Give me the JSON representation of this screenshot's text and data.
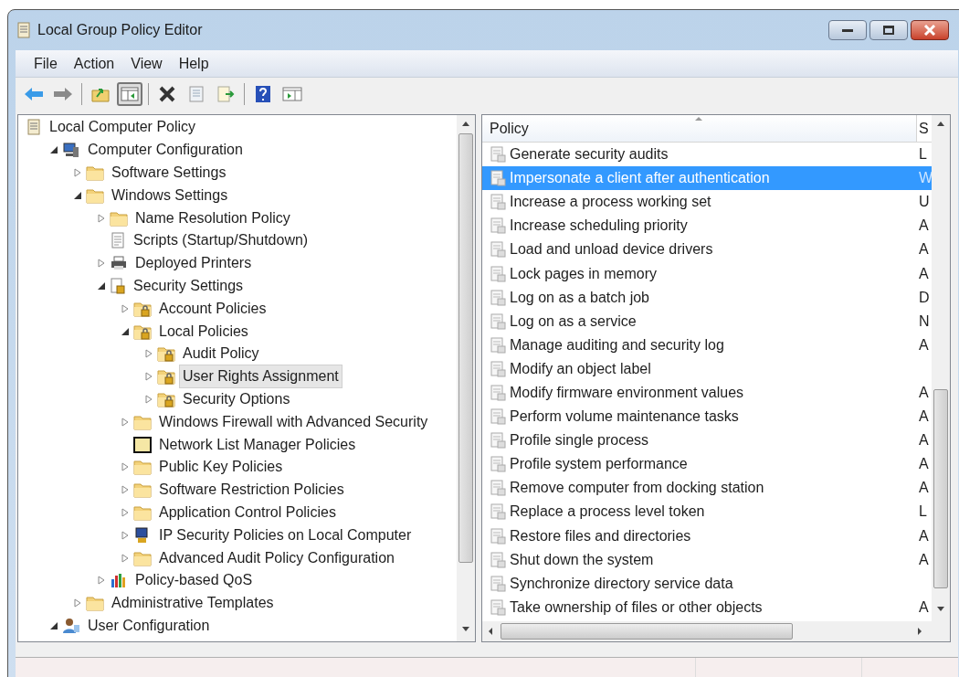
{
  "window": {
    "title": "Local Group Policy Editor"
  },
  "menu": [
    "File",
    "Action",
    "View",
    "Help"
  ],
  "toolbar": [
    {
      "kind": "back",
      "pressed": false
    },
    {
      "kind": "forward",
      "pressed": false
    },
    {
      "kind": "sep"
    },
    {
      "kind": "up",
      "pressed": false
    },
    {
      "kind": "tree",
      "pressed": true
    },
    {
      "kind": "sep"
    },
    {
      "kind": "delete",
      "pressed": false
    },
    {
      "kind": "properties",
      "pressed": false
    },
    {
      "kind": "export",
      "pressed": false
    },
    {
      "kind": "sep"
    },
    {
      "kind": "help",
      "pressed": false
    },
    {
      "kind": "pane",
      "pressed": false
    }
  ],
  "tree": [
    {
      "label": "Local Computer Policy",
      "kind": "policy",
      "selected": false,
      "children": [
        {
          "label": "Computer Configuration",
          "kind": "computer",
          "expanded": true,
          "selected": false,
          "children": [
            {
              "label": "Software Settings",
              "kind": "folder",
              "expanded": false,
              "selected": false
            },
            {
              "label": "Windows Settings",
              "kind": "folder",
              "expanded": true,
              "selected": false,
              "children": [
                {
                  "label": "Name Resolution Policy",
                  "kind": "folder",
                  "expanded": false,
                  "selected": false
                },
                {
                  "label": "Scripts (Startup/Shutdown)",
                  "kind": "script",
                  "selected": false
                },
                {
                  "label": "Deployed Printers",
                  "kind": "printer",
                  "expanded": false,
                  "selected": false
                },
                {
                  "label": "Security Settings",
                  "kind": "security",
                  "expanded": true,
                  "selected": false,
                  "children": [
                    {
                      "label": "Account Policies",
                      "kind": "locked",
                      "expanded": false,
                      "selected": false
                    },
                    {
                      "label": "Local Policies",
                      "kind": "locked",
                      "expanded": true,
                      "selected": false,
                      "children": [
                        {
                          "label": "Audit Policy",
                          "kind": "locked",
                          "expanded": false,
                          "selected": false
                        },
                        {
                          "label": "User Rights Assignment",
                          "kind": "locked",
                          "expanded": false,
                          "selected": true
                        },
                        {
                          "label": "Security Options",
                          "kind": "locked",
                          "expanded": false,
                          "selected": false
                        }
                      ]
                    },
                    {
                      "label": "Windows Firewall with Advanced Security",
                      "kind": "folder",
                      "expanded": false,
                      "selected": false
                    },
                    {
                      "label": "Network List Manager Policies",
                      "kind": "network",
                      "selected": false
                    },
                    {
                      "label": "Public Key Policies",
                      "kind": "folder",
                      "expanded": false,
                      "selected": false
                    },
                    {
                      "label": "Software Restriction Policies",
                      "kind": "folder",
                      "expanded": false,
                      "selected": false
                    },
                    {
                      "label": "Application Control Policies",
                      "kind": "folder",
                      "expanded": false,
                      "selected": false
                    },
                    {
                      "label": "IP Security Policies on Local Computer",
                      "kind": "ip",
                      "expanded": false,
                      "selected": false
                    },
                    {
                      "label": "Advanced Audit Policy Configuration",
                      "kind": "folder",
                      "expanded": false,
                      "selected": false
                    }
                  ]
                },
                {
                  "label": "Policy-based QoS",
                  "kind": "qos",
                  "expanded": false,
                  "selected": false
                }
              ]
            },
            {
              "label": "Administrative Templates",
              "kind": "folder",
              "expanded": false,
              "selected": false
            }
          ]
        },
        {
          "label": "User Configuration",
          "kind": "user",
          "expanded": true,
          "selected": false
        }
      ]
    }
  ],
  "table": {
    "columns": [
      "Policy",
      "S"
    ],
    "rows": [
      {
        "policy": "Generate security audits",
        "column_2": "L",
        "selected": false
      },
      {
        "policy": "Impersonate a client after authentication",
        "column_2": "W",
        "selected": true
      },
      {
        "policy": "Increase a process working set",
        "column_2": "U",
        "selected": false
      },
      {
        "policy": "Increase scheduling priority",
        "column_2": "A",
        "selected": false
      },
      {
        "policy": "Load and unload device drivers",
        "column_2": "A",
        "selected": false
      },
      {
        "policy": "Lock pages in memory",
        "column_2": "A",
        "selected": false
      },
      {
        "policy": "Log on as a batch job",
        "column_2": "D",
        "selected": false
      },
      {
        "policy": "Log on as a service",
        "column_2": "N",
        "selected": false
      },
      {
        "policy": "Manage auditing and security log",
        "column_2": "A",
        "selected": false
      },
      {
        "policy": "Modify an object label",
        "selected": false
      },
      {
        "policy": "Modify firmware environment values",
        "column_2": "A",
        "selected": false
      },
      {
        "policy": "Perform volume maintenance tasks",
        "column_2": "A",
        "selected": false
      },
      {
        "policy": "Profile single process",
        "column_2": "A",
        "selected": false
      },
      {
        "policy": "Profile system performance",
        "column_2": "A",
        "selected": false
      },
      {
        "policy": "Remove computer from docking station",
        "column_2": "A",
        "selected": false
      },
      {
        "policy": "Replace a process level token",
        "column_2": "L",
        "selected": false
      },
      {
        "policy": "Restore files and directories",
        "column_2": "A",
        "selected": false
      },
      {
        "policy": "Shut down the system",
        "column_2": "A",
        "selected": false
      },
      {
        "policy": "Synchronize directory service data",
        "selected": false
      },
      {
        "policy": "Take ownership of files or other objects",
        "column_2": "A",
        "selected": false
      }
    ]
  }
}
